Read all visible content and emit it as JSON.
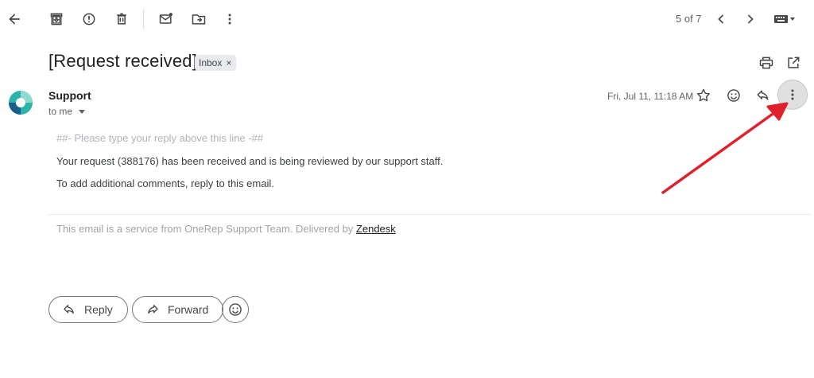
{
  "toolbar": {
    "back_icon": "arrow-back-icon",
    "archive_icon": "archive-icon",
    "spam_icon": "report-spam-icon",
    "delete_icon": "trash-icon",
    "mark_unread_icon": "mark-unread-icon",
    "move_icon": "move-to-folder-icon",
    "more_icon": "more-vertical-icon",
    "pager": "5 of 7",
    "prev_icon": "chevron-left-icon",
    "next_icon": "chevron-right-icon",
    "input_tools_icon": "keyboard-icon"
  },
  "email": {
    "subject": "[Request received]",
    "label": "Inbox",
    "label_remove": "×",
    "sender": "Support",
    "recipient": "to me",
    "date": "Fri, Jul 11, 11:18 AM",
    "body": {
      "hint": "##- Please type your reply above this line -##",
      "line1": "Your request (388176) has been received and is being reviewed by our support staff.",
      "line2": "To add additional comments, reply to this email."
    },
    "footer": {
      "text": "This email is a service from OneRep Support Team. Delivered by ",
      "link": "Zendesk"
    }
  },
  "actions": {
    "reply": "Reply",
    "forward": "Forward"
  },
  "colors": {
    "annotation_arrow": "#e0202b",
    "avatar_teal": "#2bb5a8",
    "avatar_blue": "#1b5e8c"
  }
}
